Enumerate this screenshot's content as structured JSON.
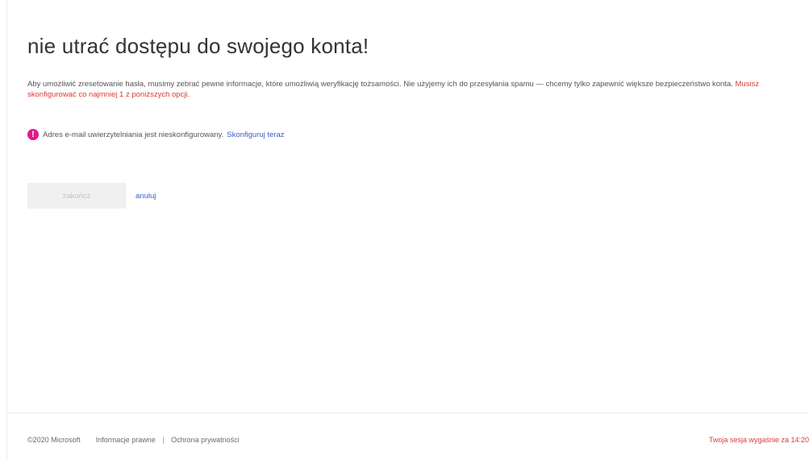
{
  "page": {
    "title": "nie utrać dostępu do swojego konta!",
    "intro_text": "Aby umożliwić zresetowanie hasła, musimy zebrać pewne informacje, które umożliwią weryfikację tożsamości. Nie użyjemy ich do przesyłania spamu — chcemy tylko zapewnić większe bezpieczeństwo konta.",
    "intro_required": "Musisz skonfigurować co najmniej 1 z poniższych opcji."
  },
  "status": {
    "icon": "exclamation-icon",
    "icon_glyph": "!",
    "icon_color": "#e3188b",
    "text": "Adres e-mail uwierzytelniania jest nieskonfigurowany.",
    "link": "Skonfiguruj teraz"
  },
  "actions": {
    "finish_label": "zakończ",
    "cancel_label": "anuluj"
  },
  "footer": {
    "copyright": "©2020 Microsoft",
    "legal_link": "Informacje prawne",
    "separator": "|",
    "privacy_link": "Ochrona prywatności",
    "session": "Twoja sesja wygaśnie za 14:20"
  },
  "colors": {
    "accent_link": "#3a5ec4",
    "warning_text": "#d83b3b"
  }
}
